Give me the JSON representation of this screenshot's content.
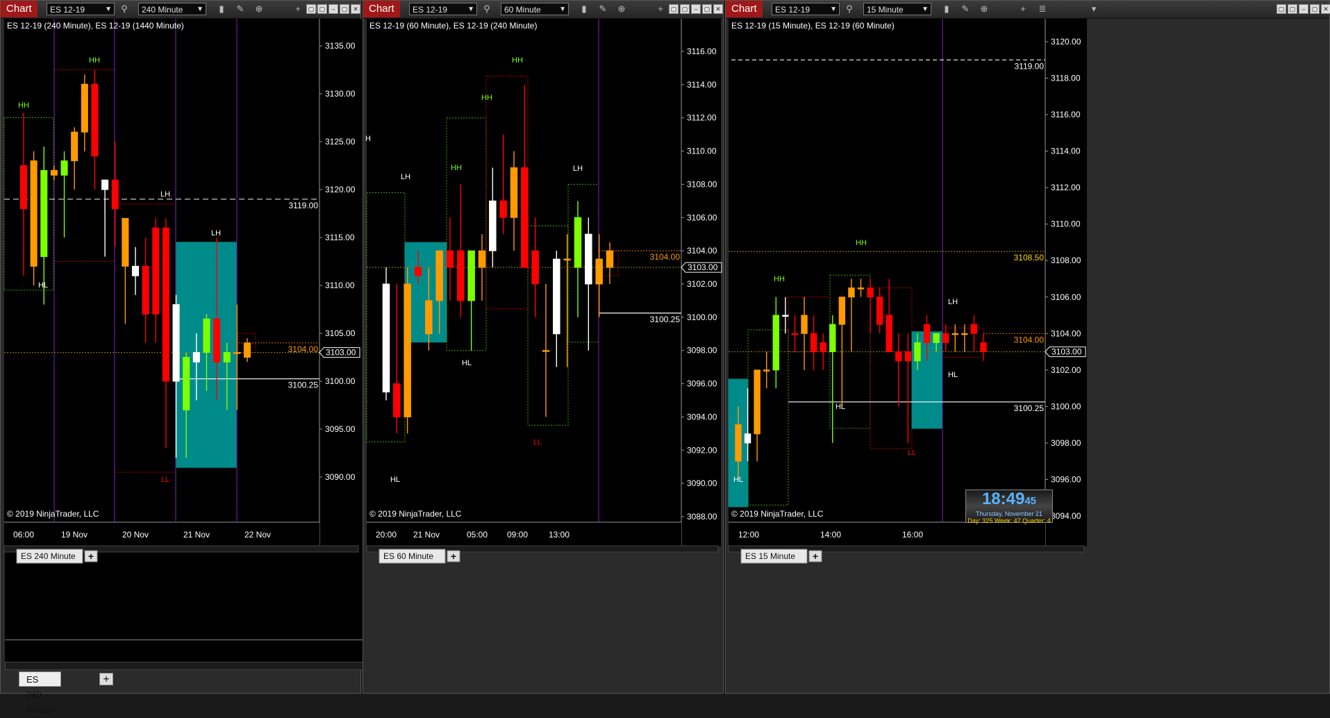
{
  "copyright": "© 2019 NinjaTrader, LLC",
  "window_button_glyphs": [
    "▢",
    "▢",
    "–",
    "▢",
    "✕"
  ],
  "colors": {
    "up": "#ff9a00",
    "down": "#ff0000",
    "bull": "#7cff00",
    "white": "#ffffff",
    "box_cyan": "#008b8b",
    "vline": "#6a1e9e",
    "price_cur": "#ffffff",
    "price_target": "#ff9a00",
    "price_yellow": "#ffd400"
  },
  "windows": [
    {
      "chart_label": "Chart",
      "instrument": "ES 12-19",
      "period": "240 Minute",
      "caption": "ES 12-19 (240 Minute), ES 12-19 (1440 Minute)",
      "tab_label": "ES  240 Minute",
      "price_labels": [
        "3135.00",
        "3130.00",
        "3125.00",
        "3120.00",
        "3115.00",
        "3110.00",
        "3105.00",
        "3100.00",
        "3095.00",
        "3090.00"
      ],
      "current_price": "3103.00",
      "level_labels": [
        {
          "text": "3119.00"
        },
        {
          "text": "3104.00"
        },
        {
          "text": "3100.25"
        }
      ],
      "time_labels": [
        "06:00",
        "19 Nov",
        "20 Nov",
        "21 Nov",
        "22 Nov"
      ],
      "swing_labels": [
        "HH",
        "HL",
        "HH",
        "LH",
        "LL",
        "LH"
      ]
    },
    {
      "chart_label": "Chart",
      "instrument": "ES 12-19",
      "period": "60 Minute",
      "caption": "ES 12-19 (60 Minute), ES 12-19 (240 Minute)",
      "tab_label": "ES  60 Minute",
      "price_labels": [
        "3116.00",
        "3114.00",
        "3112.00",
        "3110.00",
        "3108.00",
        "3106.00",
        "3104.00",
        "3102.00",
        "3100.00",
        "3098.00",
        "3096.00",
        "3094.00",
        "3092.00",
        "3090.00",
        "3088.00"
      ],
      "current_price": "3103.00",
      "level_labels": [
        {
          "text": "3104.00"
        },
        {
          "text": "3100.25"
        }
      ],
      "time_labels": [
        "20:00",
        "21 Nov",
        "05:00",
        "09:00",
        "13:00"
      ],
      "swing_labels": [
        "H",
        "LH",
        "HL",
        "HH",
        "HH",
        "HH",
        "HL",
        "LL",
        "LH"
      ]
    },
    {
      "chart_label": "Chart",
      "instrument": "ES 12-19",
      "period": "15 Minute",
      "caption": "ES 12-19 (15 Minute), ES 12-19 (60 Minute)",
      "tab_label": "ES  15 Minute",
      "price_labels": [
        "3120.00",
        "3118.00",
        "3116.00",
        "3114.00",
        "3112.00",
        "3110.00",
        "3108.00",
        "3106.00",
        "3104.00",
        "3102.00",
        "3100.00",
        "3098.00",
        "3096.00",
        "3094.00"
      ],
      "current_price": "3103.00",
      "level_labels": [
        {
          "text": "3119.00"
        },
        {
          "text": "3108.50"
        },
        {
          "text": "3104.00"
        },
        {
          "text": "3100.25"
        }
      ],
      "time_labels": [
        "12:00",
        "14:00",
        "16:00"
      ],
      "swing_labels": [
        "HH",
        "HH",
        "HL",
        "HL",
        "LH",
        "HL",
        "LL"
      ]
    }
  ],
  "clock": {
    "time": "18:49",
    "seconds": "45",
    "date": "Thursday, November 21",
    "stats": "Day: 325  Week: 47  Quarter: 4"
  },
  "chart_data": [
    {
      "type": "candlestick",
      "title": "ES 12-19 (240 Minute), ES 12-19 (1440 Minute)",
      "ylim": [
        3085.5,
        3140
      ],
      "candles": [
        {
          "o": 3122.5,
          "h": 3128,
          "l": 3111,
          "c": 3118
        },
        {
          "o": 3112,
          "h": 3124,
          "l": 3110,
          "c": 3123
        },
        {
          "o": 3113,
          "h": 3124.5,
          "l": 3108,
          "c": 3122
        },
        {
          "o": 3121.5,
          "h": 3122.5,
          "l": 3121,
          "c": 3122
        },
        {
          "o": 3121.5,
          "h": 3124,
          "l": 3115,
          "c": 3123
        },
        {
          "o": 3123,
          "h": 3126.5,
          "l": 3120,
          "c": 3126
        },
        {
          "o": 3126,
          "h": 3132,
          "l": 3124,
          "c": 3131
        },
        {
          "o": 3131,
          "h": 3132.5,
          "l": 3120,
          "c": 3123.5
        },
        {
          "o": 3120,
          "h": 3121,
          "l": 3113,
          "c": 3121
        },
        {
          "o": 3121,
          "h": 3125,
          "l": 3114,
          "c": 3118
        },
        {
          "o": 3112,
          "h": 3117,
          "l": 3106,
          "c": 3117
        },
        {
          "o": 3111,
          "h": 3114,
          "l": 3109,
          "c": 3112
        },
        {
          "o": 3112,
          "h": 3115,
          "l": 3104,
          "c": 3107
        },
        {
          "o": 3116,
          "h": 3117,
          "l": 3104,
          "c": 3107
        },
        {
          "o": 3116,
          "h": 3117,
          "l": 3093,
          "c": 3100
        },
        {
          "o": 3108,
          "h": 3109,
          "l": 3092,
          "c": 3100
        },
        {
          "o": 3097,
          "h": 3103,
          "l": 3092,
          "c": 3102.5
        },
        {
          "o": 3102,
          "h": 3105,
          "l": 3098,
          "c": 3103
        },
        {
          "o": 3103,
          "h": 3107,
          "l": 3099,
          "c": 3106.5
        },
        {
          "o": 3106.5,
          "h": 3115,
          "l": 3098,
          "c": 3102
        },
        {
          "o": 3102,
          "h": 3104,
          "l": 3097,
          "c": 3103
        },
        {
          "o": 3103,
          "h": 3108,
          "l": 3097,
          "c": 3103
        },
        {
          "o": 3102.5,
          "h": 3104.5,
          "l": 3102,
          "c": 3104
        }
      ],
      "levels": [
        3119.0,
        3104.0,
        3103.0,
        3100.25
      ]
    },
    {
      "type": "candlestick",
      "title": "ES 12-19 (60 Minute), ES 12-19 (240 Minute)",
      "ylim": [
        3087.5,
        3117.7
      ],
      "candles": [
        {
          "o": 3102,
          "h": 3103,
          "l": 3095,
          "c": 3095.5
        },
        {
          "o": 3096,
          "h": 3102,
          "l": 3093,
          "c": 3094
        },
        {
          "o": 3094,
          "h": 3103,
          "l": 3093,
          "c": 3102
        },
        {
          "o": 3103,
          "h": 3104,
          "l": 3102,
          "c": 3102.5
        },
        {
          "o": 3099,
          "h": 3103,
          "l": 3098,
          "c": 3101
        },
        {
          "o": 3101,
          "h": 3104,
          "l": 3099,
          "c": 3104
        },
        {
          "o": 3104,
          "h": 3106,
          "l": 3101,
          "c": 3103
        },
        {
          "o": 3104,
          "h": 3108,
          "l": 3100,
          "c": 3101
        },
        {
          "o": 3101,
          "h": 3104,
          "l": 3098,
          "c": 3104
        },
        {
          "o": 3103,
          "h": 3105,
          "l": 3101,
          "c": 3104
        },
        {
          "o": 3104,
          "h": 3109,
          "l": 3103,
          "c": 3107
        },
        {
          "o": 3107,
          "h": 3111,
          "l": 3105,
          "c": 3106
        },
        {
          "o": 3106,
          "h": 3110,
          "l": 3104,
          "c": 3109
        },
        {
          "o": 3109,
          "h": 3114,
          "l": 3103,
          "c": 3103
        },
        {
          "o": 3104,
          "h": 3106,
          "l": 3100,
          "c": 3102
        },
        {
          "o": 3098,
          "h": 3102,
          "l": 3094,
          "c": 3098
        },
        {
          "o": 3099,
          "h": 3104,
          "l": 3097,
          "c": 3103.5
        },
        {
          "o": 3103.5,
          "h": 3105,
          "l": 3097,
          "c": 3103.5
        },
        {
          "o": 3103,
          "h": 3107,
          "l": 3100,
          "c": 3106
        },
        {
          "o": 3105,
          "h": 3106,
          "l": 3098,
          "c": 3102
        },
        {
          "o": 3102,
          "h": 3105,
          "l": 3100,
          "c": 3103.5
        },
        {
          "o": 3103,
          "h": 3104.5,
          "l": 3102,
          "c": 3104
        }
      ],
      "levels": [
        3104.0,
        3103.0,
        3100.25
      ]
    },
    {
      "type": "candlestick",
      "title": "ES 12-19 (15 Minute), ES 12-19 (60 Minute)",
      "ylim": [
        3093.5,
        3120.8
      ],
      "candles": [
        {
          "o": 3097,
          "h": 3100,
          "l": 3096,
          "c": 3099
        },
        {
          "o": 3098,
          "h": 3101,
          "l": 3097,
          "c": 3098.5
        },
        {
          "o": 3098.5,
          "h": 3102,
          "l": 3097,
          "c": 3102
        },
        {
          "o": 3102,
          "h": 3103,
          "l": 3101,
          "c": 3102
        },
        {
          "o": 3102,
          "h": 3106,
          "l": 3101,
          "c": 3105
        },
        {
          "o": 3105,
          "h": 3106,
          "l": 3104,
          "c": 3105
        },
        {
          "o": 3104,
          "h": 3105,
          "l": 3103,
          "c": 3104
        },
        {
          "o": 3104,
          "h": 3106,
          "l": 3102,
          "c": 3105
        },
        {
          "o": 3104,
          "h": 3105,
          "l": 3102,
          "c": 3103
        },
        {
          "o": 3103.5,
          "h": 3104,
          "l": 3102,
          "c": 3103
        },
        {
          "o": 3103,
          "h": 3105,
          "l": 3098,
          "c": 3104.5
        },
        {
          "o": 3104.5,
          "h": 3106,
          "l": 3100,
          "c": 3106
        },
        {
          "o": 3106,
          "h": 3107,
          "l": 3103,
          "c": 3106.5
        },
        {
          "o": 3106.5,
          "h": 3107,
          "l": 3106,
          "c": 3106.5
        },
        {
          "o": 3106.5,
          "h": 3107,
          "l": 3104,
          "c": 3106
        },
        {
          "o": 3106,
          "h": 3106.5,
          "l": 3104,
          "c": 3104.5
        },
        {
          "o": 3105,
          "h": 3107,
          "l": 3103,
          "c": 3103
        },
        {
          "o": 3103,
          "h": 3104,
          "l": 3100,
          "c": 3102.5
        },
        {
          "o": 3103,
          "h": 3104,
          "l": 3098,
          "c": 3102.5
        },
        {
          "o": 3102.5,
          "h": 3104,
          "l": 3102,
          "c": 3103.5
        },
        {
          "o": 3104.5,
          "h": 3105,
          "l": 3102.5,
          "c": 3103.5
        },
        {
          "o": 3103.5,
          "h": 3104,
          "l": 3103,
          "c": 3104
        },
        {
          "o": 3104,
          "h": 3104.5,
          "l": 3103,
          "c": 3103.5
        },
        {
          "o": 3104,
          "h": 3104.5,
          "l": 3103,
          "c": 3104
        },
        {
          "o": 3104,
          "h": 3104.5,
          "l": 3103,
          "c": 3104
        },
        {
          "o": 3104.5,
          "h": 3105,
          "l": 3103,
          "c": 3104
        },
        {
          "o": 3103.5,
          "h": 3104,
          "l": 3102.5,
          "c": 3103
        }
      ],
      "levels": [
        3119.0,
        3108.5,
        3104.0,
        3103.0,
        3100.25
      ]
    }
  ]
}
